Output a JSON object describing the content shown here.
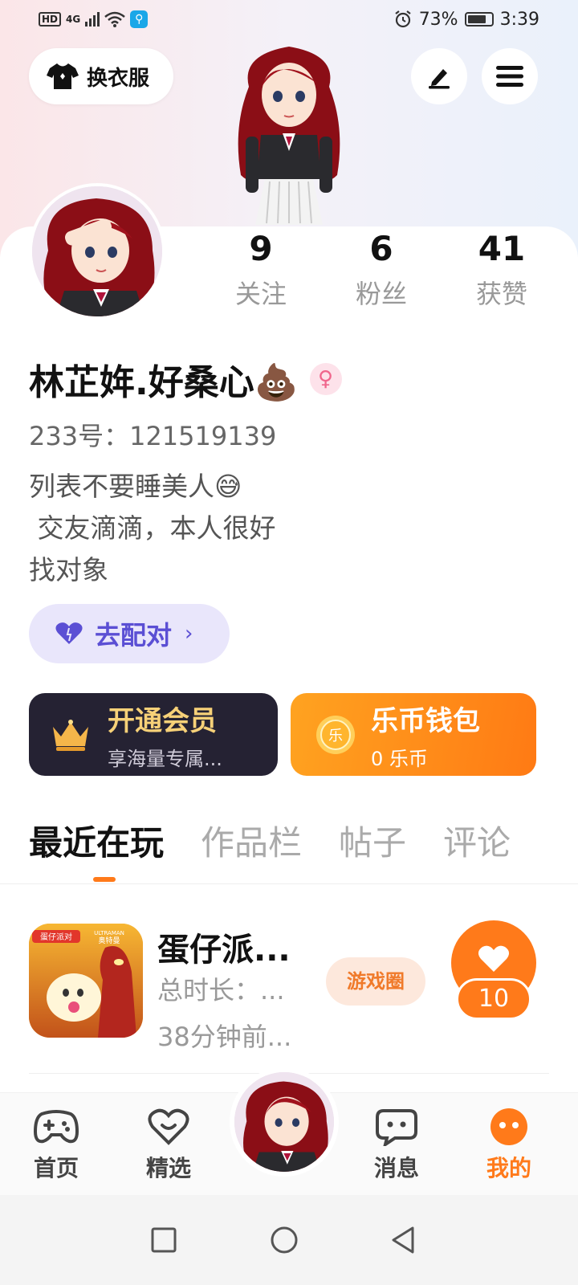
{
  "status_bar": {
    "network_label": "HD",
    "network_type": "4G",
    "alarm_icon": "alarm-icon",
    "battery_percent": "73%",
    "time": "3:39"
  },
  "header": {
    "wardrobe_label": "换衣服",
    "edit_icon": "edit-icon",
    "menu_icon": "menu-icon"
  },
  "profile": {
    "stats": [
      {
        "value": "9",
        "label": "关注"
      },
      {
        "value": "6",
        "label": "粉丝"
      },
      {
        "value": "41",
        "label": "获赞"
      }
    ],
    "username": "林芷姩.好桑心💩",
    "gender_symbol": "♀",
    "user_id": "233号：121519139",
    "bio_lines": [
      "列表不要睡美人😅",
      " 交友滴滴，本人很好",
      "找对象"
    ],
    "match_label": "去配对",
    "match_chevron": "›"
  },
  "cards": {
    "vip_title": "开通会员",
    "vip_subtitle": "享海量专属...",
    "wallet_title": "乐币钱包",
    "wallet_subtitle": "0 乐币",
    "wallet_coin_glyph": "乐"
  },
  "tabs": [
    {
      "label": "最近在玩",
      "active": true
    },
    {
      "label": "作品栏",
      "active": false
    },
    {
      "label": "帖子",
      "active": false
    },
    {
      "label": "评论",
      "active": false
    }
  ],
  "recent_games": [
    {
      "name": "蛋仔派...",
      "total_time": "总时长：...",
      "last_played": "38分钟前...",
      "circle_label": "游戏圈",
      "likes": "10",
      "icon_text_1": "蛋仔派对",
      "icon_text_2": "ULTRAMAN",
      "icon_text_3": "奥特曼"
    }
  ],
  "bottom_nav": [
    {
      "label": "首页",
      "icon": "gamepad-icon",
      "active": false
    },
    {
      "label": "精选",
      "icon": "heart-icon",
      "active": false
    },
    {
      "label": "消息",
      "icon": "chat-icon",
      "active": false
    },
    {
      "label": "我的",
      "icon": "face-icon",
      "active": true
    }
  ],
  "colors": {
    "accent": "#ff7a1a",
    "match_purple": "#5b4fd4",
    "vip_gold": "#f7d178",
    "vip_bg": "#252233"
  }
}
